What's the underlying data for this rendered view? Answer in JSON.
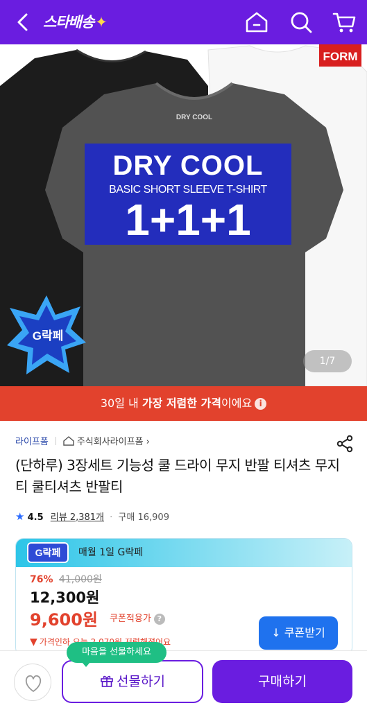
{
  "topbar": {
    "logo_text": "스타배송",
    "logo_spark": "✦",
    "icons": [
      "back-icon",
      "home-icon",
      "search-icon",
      "cart-icon"
    ]
  },
  "hero": {
    "brand_tag": "FORM",
    "banner_line1": "DRY COOL",
    "banner_line2": "BASIC SHORT SLEEVE T-SHIRT",
    "banner_line3": "1+1+1",
    "badge_text": "G락페",
    "pager": "1/7"
  },
  "lowest_price_strip": {
    "prefix": "30일 내 ",
    "emphasis": "가장 저렴한 가격",
    "suffix": "이에요",
    "info_icon": "i"
  },
  "product": {
    "store": "라이프폼",
    "company": "주식회사라이프폼",
    "company_chevron": "›",
    "title": "(단하루) 3장세트 기능성 쿨 드라이 무지 반팔 티셔츠 무지티 쿨티셔츠 반팔티",
    "rating_star": "★",
    "rating": "4.5",
    "reviews": "리뷰 2,381개",
    "dot": "·",
    "sold": "구매 16,909"
  },
  "coupon_card": {
    "logo": "G락페",
    "header_text": "매월 1일 G락페",
    "discount_pct": "76%",
    "original_price": "41,000원",
    "price": "12,300원",
    "coupon_price": "9,600원",
    "coupon_note": "쿠폰적용가",
    "coupon_note_help": "?",
    "drop_arrow": "▼",
    "drop_text": "가격인하 오늘 2,070원 저렴해졌어요",
    "coupon_button_icon": "↓",
    "coupon_button": "쿠폰받기"
  },
  "bottom_bar": {
    "tooltip": "마음을 선물하세요",
    "gift_button": "선물하기",
    "buy_button": "구매하기"
  },
  "colors": {
    "brand_purple": "#6a1de0",
    "sale_red": "#e2422d",
    "coupon_blue": "#1f72ee",
    "tooltip_green": "#1fbf84"
  }
}
